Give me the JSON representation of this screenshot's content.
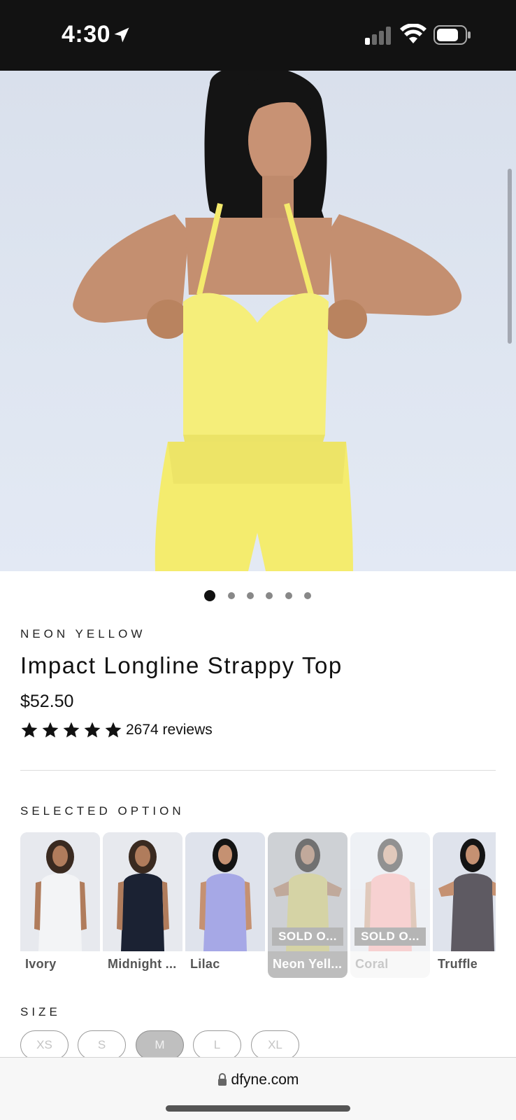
{
  "status_bar": {
    "time": "4:30"
  },
  "hero": {
    "carousel_index": 1,
    "carousel_total": 6
  },
  "product": {
    "color_label": "NEON YELLOW",
    "title": "Impact Longline Strappy Top",
    "price": "$52.50",
    "rating_stars": 5,
    "reviews": "2674 reviews"
  },
  "selected_option": {
    "label": "SELECTED OPTION",
    "swatches": [
      {
        "name": "Ivory",
        "sold_out": "",
        "state": "available",
        "color": "#f1f2f4"
      },
      {
        "name": "Midnight ...",
        "sold_out": "",
        "state": "available",
        "color": "#1b2233"
      },
      {
        "name": "Lilac",
        "sold_out": "",
        "state": "available",
        "color": "#a6a8e6"
      },
      {
        "name": "Neon Yell...",
        "sold_out": "SOLD O...",
        "state": "selected",
        "color": "#f4ef8a"
      },
      {
        "name": "Coral",
        "sold_out": "SOLD O...",
        "state": "sold_out",
        "color": "#f6a3a3"
      },
      {
        "name": "Truffle",
        "sold_out": "",
        "state": "available",
        "color": "#5e5a62"
      }
    ]
  },
  "size": {
    "label": "SIZE",
    "options": [
      "XS",
      "S",
      "M",
      "L",
      "XL"
    ],
    "selected": "M"
  },
  "browser": {
    "url": "dfyne.com"
  }
}
